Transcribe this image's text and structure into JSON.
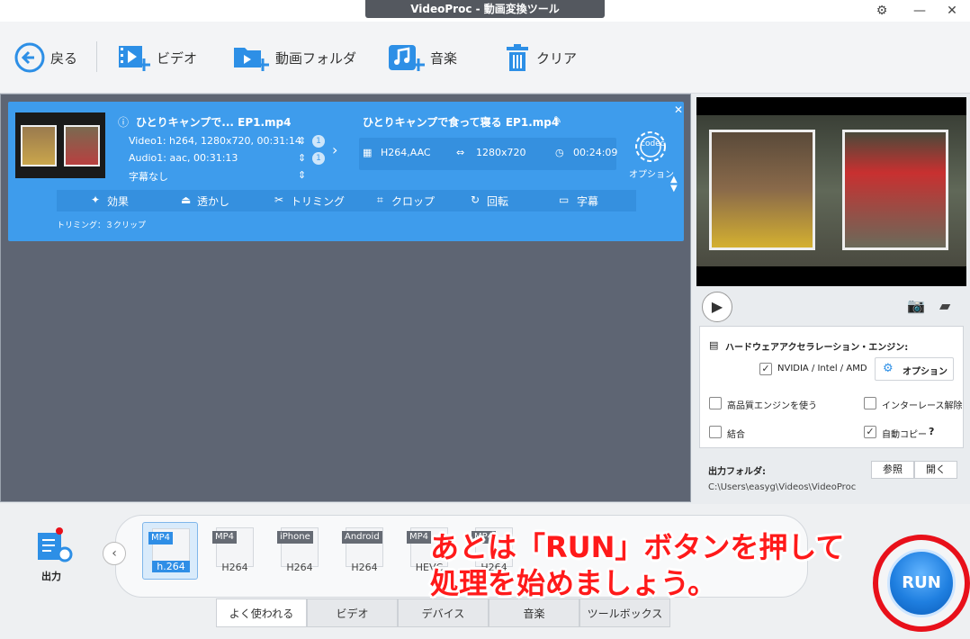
{
  "window": {
    "title": "VideoProc - 動画変換ツール"
  },
  "toolbar": {
    "back": "戻る",
    "video": "ビデオ",
    "folder": "動画フォルダ",
    "music": "音楽",
    "clear": "クリア"
  },
  "item": {
    "source_title": "ひとりキャンプで... EP1.mp4",
    "video_track": "Video1: h264, 1280x720, 00:31:14",
    "audio_track": "Audio1: aac, 00:31:13",
    "subtitle": "字幕なし",
    "video_badge": "1",
    "audio_badge": "1",
    "output_title": "ひとりキャンプで食って寝る EP1.mp4",
    "codec": "H264,AAC",
    "resolution": "1280x720",
    "duration": "00:24:09",
    "codec_label": "codec",
    "option_label": "オプション",
    "trim_note": "トリミング：３クリップ"
  },
  "edit_tools": [
    "効果",
    "透かし",
    "トリミング",
    "クロップ",
    "回転",
    "字幕"
  ],
  "settings": {
    "hw_accel": "ハードウェアアクセラレーション・エンジン:",
    "nvidia": "NVIDIA / Intel / AMD",
    "option_btn": "オプション",
    "high_quality": "高品質エンジンを使う",
    "deinterlace": "インターレース解除",
    "merge": "結合",
    "auto_copy": "自動コピー",
    "help": "?",
    "nvidia_checked": true,
    "auto_copy_checked": true
  },
  "output": {
    "label": "出力フォルダ:",
    "browse": "参照",
    "open": "開く",
    "path": "C:\\Users\\easyg\\Videos\\VideoProc"
  },
  "bottom": {
    "output_label": "出力",
    "formats": [
      {
        "tag": "MP4",
        "sub": "h.264",
        "selected": true
      },
      {
        "tag": "MP4",
        "sub": "H264",
        "selected": false
      },
      {
        "tag": "iPhone",
        "sub": "H264",
        "selected": false
      },
      {
        "tag": "Android",
        "sub": "H264",
        "selected": false
      },
      {
        "tag": "MP4",
        "sub": "HEVC",
        "selected": false
      },
      {
        "tag": "MP4",
        "sub": "H264",
        "selected": false
      }
    ],
    "tabs": [
      "よく使われる",
      "ビデオ",
      "デバイス",
      "音楽",
      "ツールボックス"
    ],
    "run": "RUN"
  },
  "annotation": {
    "line1": "あとは「RUN」ボタンを押して",
    "line2": "処理を始めましょう。"
  },
  "colors": {
    "accent": "#3e9cec",
    "highlight": "#e8101a"
  }
}
